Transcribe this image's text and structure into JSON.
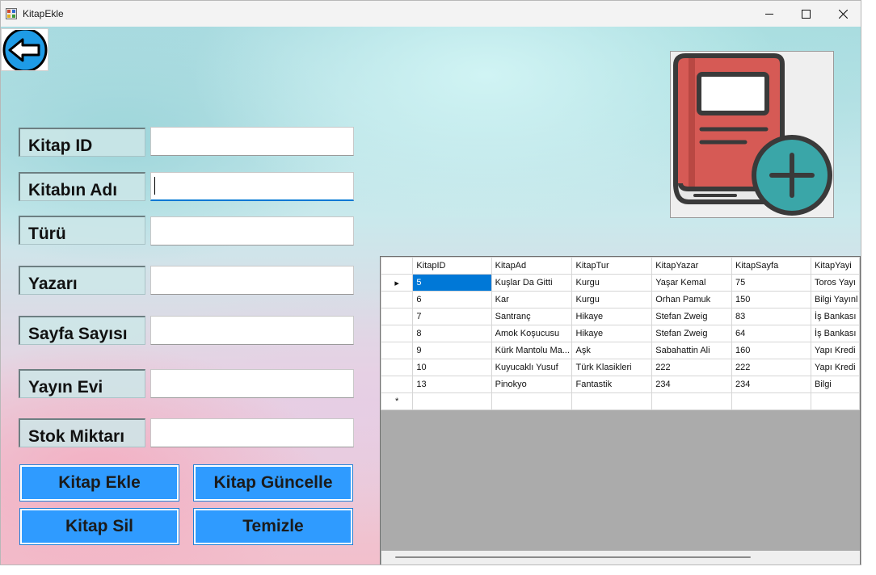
{
  "window": {
    "title": "KitapEkle",
    "app_icon": "form-app-icon",
    "controls": [
      "minimize-icon",
      "maximize-icon",
      "close-icon"
    ]
  },
  "back_button_icon": "arrow-left-icon",
  "book_image_icon": "book-add-icon",
  "form": {
    "kitap_id_label": "Kitap ID",
    "kitap_id_value": "",
    "kitap_adi_label": "Kitabın Adı",
    "kitap_adi_value": "",
    "turu_label": "Türü",
    "turu_value": "",
    "yazari_label": "Yazarı",
    "yazari_value": "",
    "sayfa_label": "Sayfa Sayısı",
    "sayfa_value": "",
    "yayin_evi_label": "Yayın Evi",
    "yayin_evi_value": "",
    "stok_label": "Stok Miktarı",
    "stok_value": ""
  },
  "buttons": {
    "add": "Kitap Ekle",
    "update": "Kitap Güncelle",
    "delete": "Kitap Sil",
    "clear": "Temizle"
  },
  "grid": {
    "columns": [
      "KitapID",
      "KitapAd",
      "KitapTur",
      "KitapYazar",
      "KitapSayfa",
      "KitapYayi"
    ],
    "rows": [
      [
        "5",
        "Kuşlar Da Gitti",
        "Kurgu",
        "Yaşar Kemal",
        "75",
        "Toros Yayı"
      ],
      [
        "6",
        "Kar",
        "Kurgu",
        "Orhan Pamuk",
        "150",
        "Bilgi Yayınl"
      ],
      [
        "7",
        "Santranç",
        "Hikaye",
        "Stefan Zweig",
        "83",
        "İş Bankası"
      ],
      [
        "8",
        "Amok Koşucusu",
        "Hikaye",
        "Stefan Zweig",
        "64",
        "İş Bankası"
      ],
      [
        "9",
        "Kürk Mantolu Ma...",
        "Aşk",
        "Sabahattin Ali",
        "160",
        "Yapı Kredi"
      ],
      [
        "10",
        "Kuyucaklı Yusuf",
        "Türk Klasikleri",
        "222",
        "222",
        "Yapı Kredi"
      ],
      [
        "13",
        "Pinokyo",
        "Fantastik",
        "234",
        "234",
        "Bilgi"
      ]
    ],
    "current_row_marker": "▸",
    "new_row_marker": "*"
  },
  "colors": {
    "button_blue": "#2f9bff",
    "selection_blue": "#0078d7",
    "focus_underline": "#0078d4",
    "book_red": "#d9534f",
    "book_add_teal": "#3aa6a8"
  }
}
